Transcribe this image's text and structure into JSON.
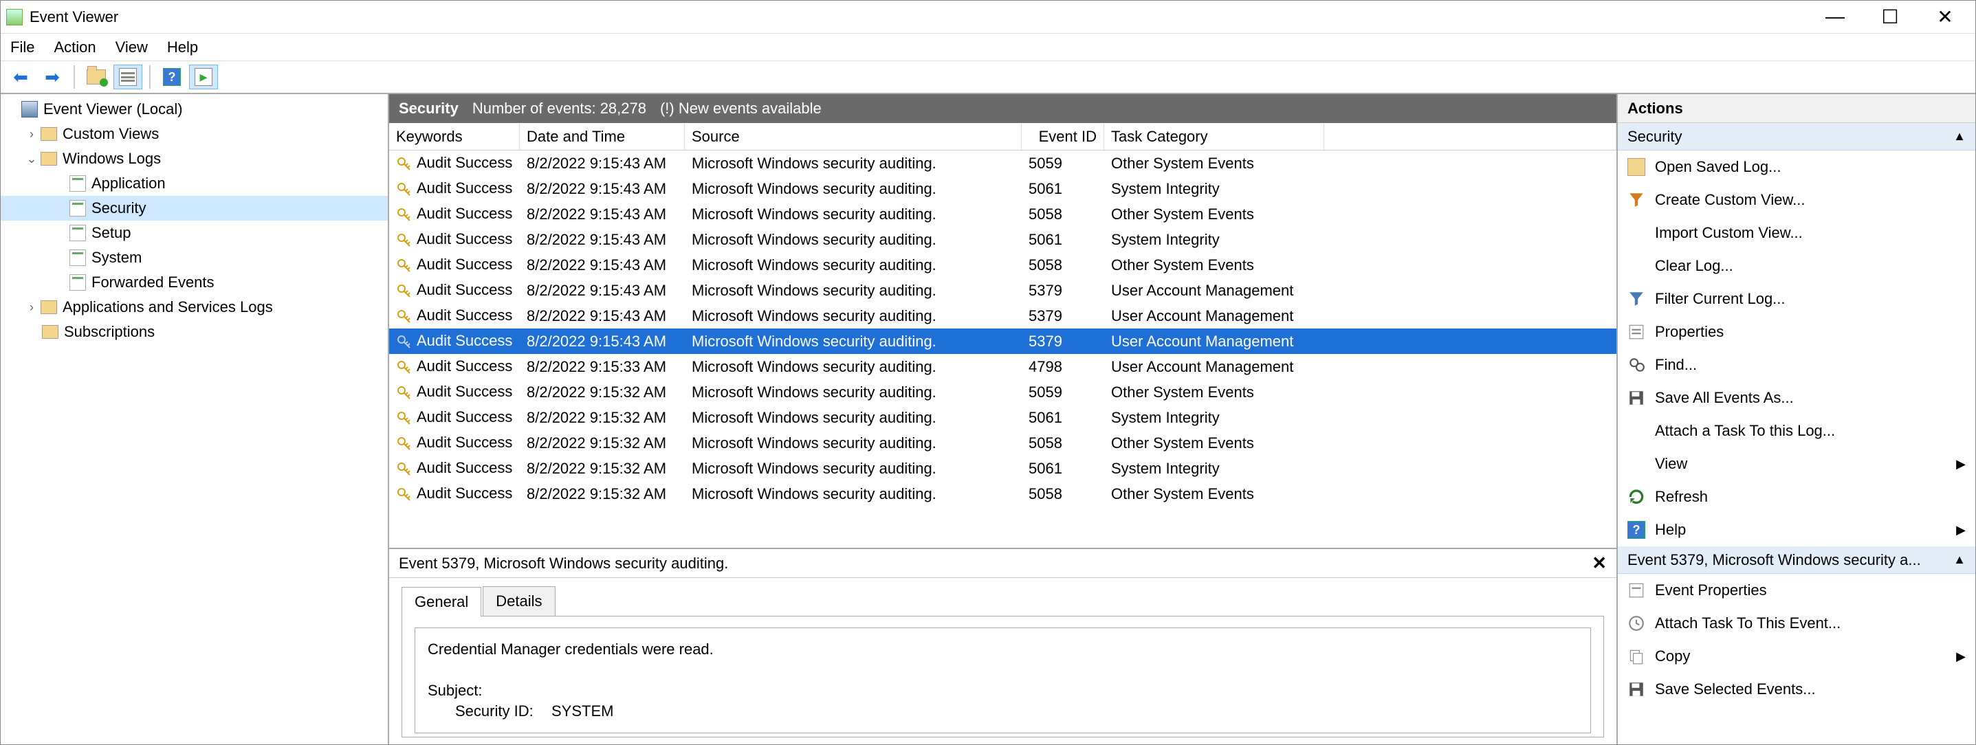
{
  "window": {
    "title": "Event Viewer"
  },
  "menu": {
    "file": "File",
    "action": "Action",
    "view": "View",
    "help": "Help"
  },
  "tree": {
    "root": "Event Viewer (Local)",
    "custom_views": "Custom Views",
    "windows_logs": "Windows Logs",
    "logs": {
      "application": "Application",
      "security": "Security",
      "setup": "Setup",
      "system": "System",
      "forwarded": "Forwarded Events"
    },
    "apps_services": "Applications and Services Logs",
    "subscriptions": "Subscriptions"
  },
  "header": {
    "title": "Security",
    "count_label": "Number of events: 28,278",
    "extra": "(!) New events available"
  },
  "columns": {
    "keywords": "Keywords",
    "datetime": "Date and Time",
    "source": "Source",
    "eventid": "Event ID",
    "taskcat": "Task Category"
  },
  "events": [
    {
      "kw": "Audit Success",
      "dt": "8/2/2022 9:15:43 AM",
      "src": "Microsoft Windows security auditing.",
      "id": "5059",
      "tc": "Other System Events",
      "sel": false
    },
    {
      "kw": "Audit Success",
      "dt": "8/2/2022 9:15:43 AM",
      "src": "Microsoft Windows security auditing.",
      "id": "5061",
      "tc": "System Integrity",
      "sel": false
    },
    {
      "kw": "Audit Success",
      "dt": "8/2/2022 9:15:43 AM",
      "src": "Microsoft Windows security auditing.",
      "id": "5058",
      "tc": "Other System Events",
      "sel": false
    },
    {
      "kw": "Audit Success",
      "dt": "8/2/2022 9:15:43 AM",
      "src": "Microsoft Windows security auditing.",
      "id": "5061",
      "tc": "System Integrity",
      "sel": false
    },
    {
      "kw": "Audit Success",
      "dt": "8/2/2022 9:15:43 AM",
      "src": "Microsoft Windows security auditing.",
      "id": "5058",
      "tc": "Other System Events",
      "sel": false
    },
    {
      "kw": "Audit Success",
      "dt": "8/2/2022 9:15:43 AM",
      "src": "Microsoft Windows security auditing.",
      "id": "5379",
      "tc": "User Account Management",
      "sel": false
    },
    {
      "kw": "Audit Success",
      "dt": "8/2/2022 9:15:43 AM",
      "src": "Microsoft Windows security auditing.",
      "id": "5379",
      "tc": "User Account Management",
      "sel": false
    },
    {
      "kw": "Audit Success",
      "dt": "8/2/2022 9:15:43 AM",
      "src": "Microsoft Windows security auditing.",
      "id": "5379",
      "tc": "User Account Management",
      "sel": true
    },
    {
      "kw": "Audit Success",
      "dt": "8/2/2022 9:15:33 AM",
      "src": "Microsoft Windows security auditing.",
      "id": "4798",
      "tc": "User Account Management",
      "sel": false
    },
    {
      "kw": "Audit Success",
      "dt": "8/2/2022 9:15:32 AM",
      "src": "Microsoft Windows security auditing.",
      "id": "5059",
      "tc": "Other System Events",
      "sel": false
    },
    {
      "kw": "Audit Success",
      "dt": "8/2/2022 9:15:32 AM",
      "src": "Microsoft Windows security auditing.",
      "id": "5061",
      "tc": "System Integrity",
      "sel": false
    },
    {
      "kw": "Audit Success",
      "dt": "8/2/2022 9:15:32 AM",
      "src": "Microsoft Windows security auditing.",
      "id": "5058",
      "tc": "Other System Events",
      "sel": false
    },
    {
      "kw": "Audit Success",
      "dt": "8/2/2022 9:15:32 AM",
      "src": "Microsoft Windows security auditing.",
      "id": "5061",
      "tc": "System Integrity",
      "sel": false
    },
    {
      "kw": "Audit Success",
      "dt": "8/2/2022 9:15:32 AM",
      "src": "Microsoft Windows security auditing.",
      "id": "5058",
      "tc": "Other System Events",
      "sel": false
    }
  ],
  "detail": {
    "title": "Event 5379, Microsoft Windows security auditing.",
    "tabs": {
      "general": "General",
      "details": "Details"
    },
    "line1": "Credential Manager credentials were read.",
    "subject_label": "Subject:",
    "sid_label": "Security ID:",
    "sid_value": "SYSTEM"
  },
  "actions": {
    "header": "Actions",
    "section1": "Security",
    "open_saved": "Open Saved Log...",
    "create_custom": "Create Custom View...",
    "import_custom": "Import Custom View...",
    "clear_log": "Clear Log...",
    "filter_log": "Filter Current Log...",
    "properties": "Properties",
    "find": "Find...",
    "save_all": "Save All Events As...",
    "attach_task": "Attach a Task To this Log...",
    "view": "View",
    "refresh": "Refresh",
    "help": "Help",
    "section2": "Event 5379, Microsoft Windows security a...",
    "event_props": "Event Properties",
    "attach_event": "Attach Task To This Event...",
    "copy": "Copy",
    "save_selected": "Save Selected Events..."
  }
}
